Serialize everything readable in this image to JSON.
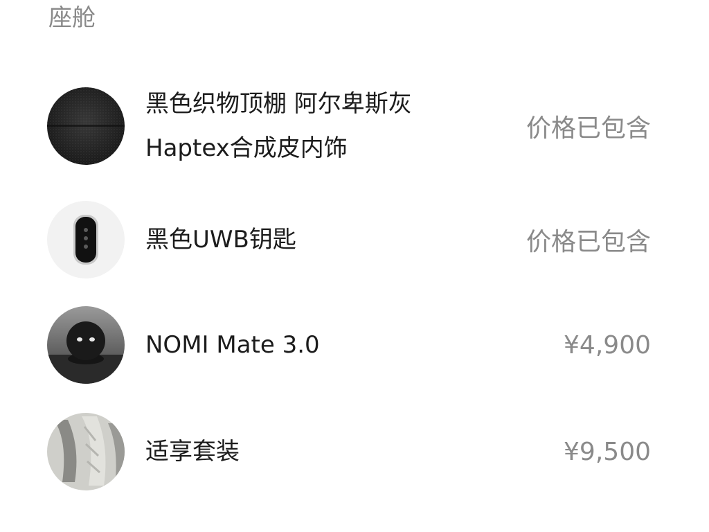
{
  "section": {
    "title": "座舱"
  },
  "items": [
    {
      "name_line1": "黑色织物顶棚 阿尔卑斯灰",
      "name_line2": "Haptex合成皮内饰",
      "price": "价格已包含",
      "image": "black-fabric-swatch"
    },
    {
      "name_line1": "黑色UWB钥匙",
      "price": "价格已包含",
      "image": "uwb-key-fob"
    },
    {
      "name_line1": "NOMI Mate 3.0",
      "price": "¥4,900",
      "image": "nomi-mate-robot"
    },
    {
      "name_line1": "适享套装",
      "price": "¥9,500",
      "image": "seat-interior"
    }
  ]
}
